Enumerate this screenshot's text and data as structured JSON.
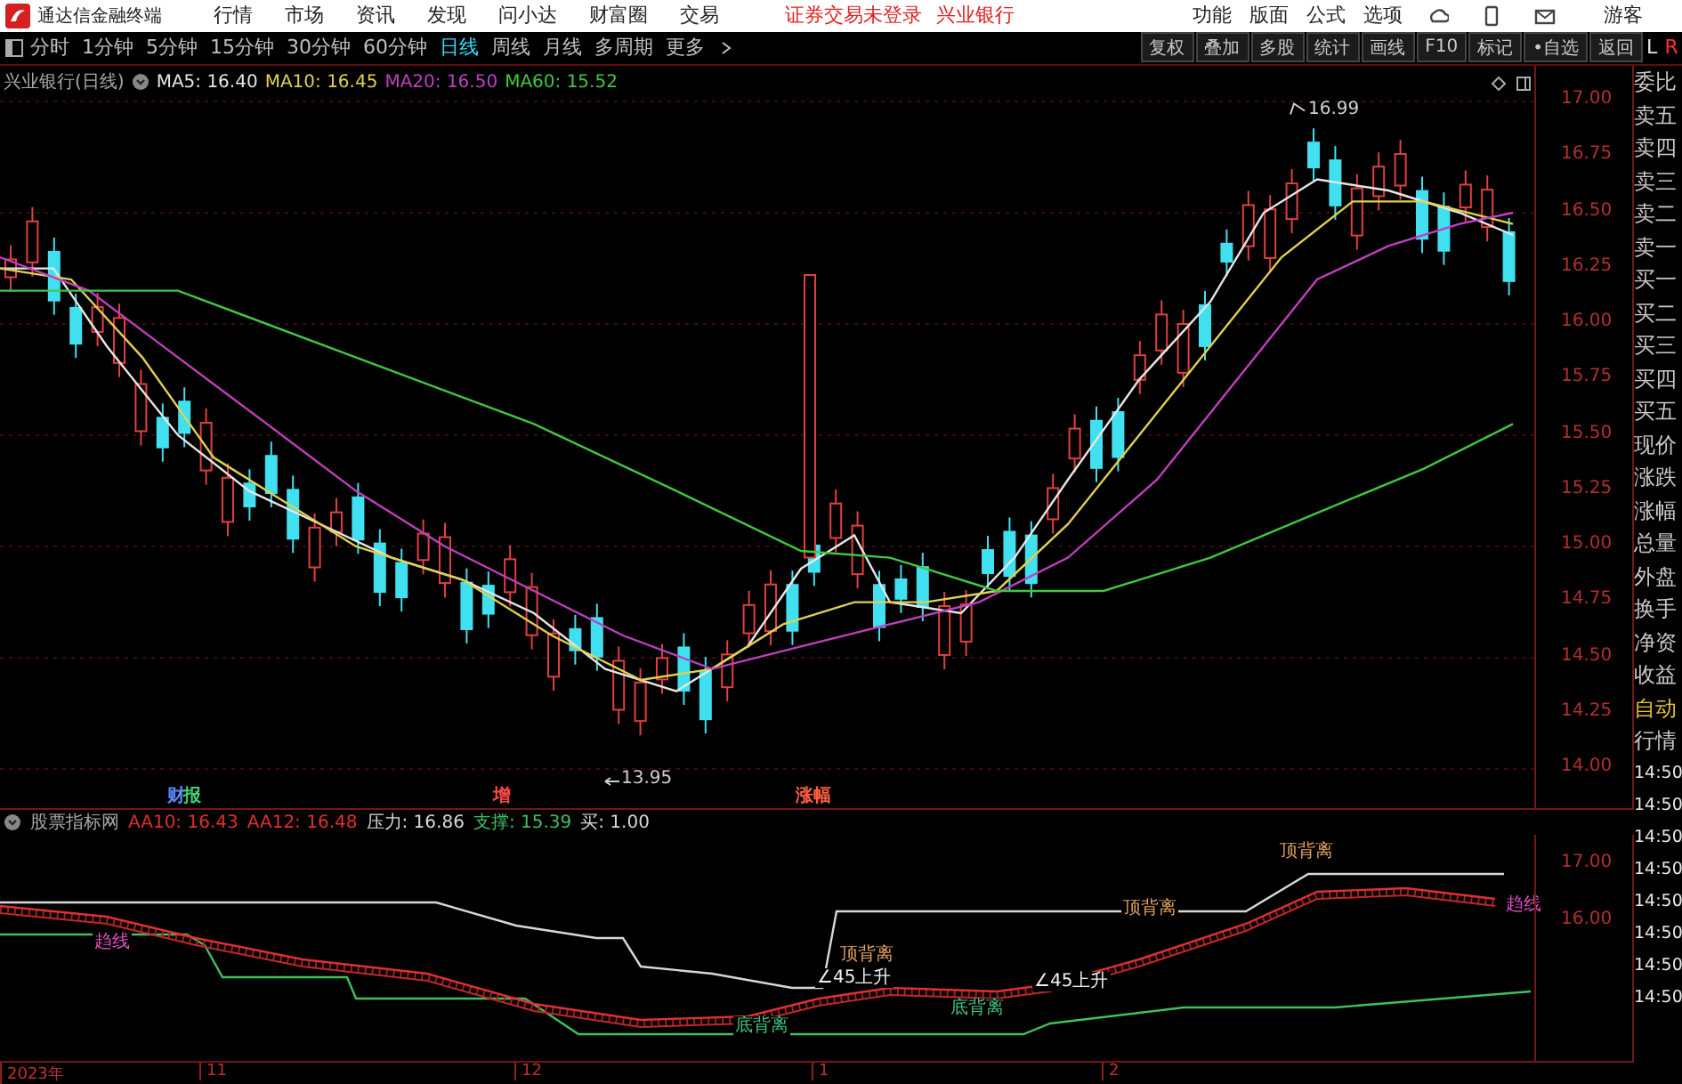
{
  "title_bar": {
    "app_title": "通达信金融终端",
    "menus": [
      "行情",
      "市场",
      "资讯",
      "发现",
      "问小达",
      "财富圈",
      "交易"
    ],
    "notices": [
      "证券交易未登录",
      "兴业银行"
    ],
    "right_menus": [
      "功能",
      "版面",
      "公式",
      "选项"
    ],
    "user": "游客"
  },
  "toolbar": {
    "periods": [
      {
        "label": "分时",
        "selected": false
      },
      {
        "label": "1分钟",
        "selected": false
      },
      {
        "label": "5分钟",
        "selected": false
      },
      {
        "label": "15分钟",
        "selected": false
      },
      {
        "label": "30分钟",
        "selected": false
      },
      {
        "label": "60分钟",
        "selected": false
      },
      {
        "label": "日线",
        "selected": true
      },
      {
        "label": "周线",
        "selected": false
      },
      {
        "label": "月线",
        "selected": false
      },
      {
        "label": "多周期",
        "selected": false
      },
      {
        "label": "更多",
        "selected": false
      }
    ],
    "buttons": [
      "复权",
      "叠加",
      "多股",
      "统计",
      "画线",
      "F10",
      "标记",
      "•自选",
      "返回"
    ],
    "side_marks": [
      "L",
      "R"
    ]
  },
  "price_chart": {
    "title": "兴业银行(日线)",
    "ma": [
      {
        "label": "MA5: 16.40",
        "color": "#e6e6e6"
      },
      {
        "label": "MA10: 16.45",
        "color": "#e0d050"
      },
      {
        "label": "MA20: 16.50",
        "color": "#c040c0"
      },
      {
        "label": "MA60: 15.52",
        "color": "#40c840"
      }
    ],
    "y_ticks": [
      "17.00",
      "16.75",
      "16.50",
      "16.25",
      "16.00",
      "15.75",
      "15.50",
      "15.25",
      "15.00",
      "14.75",
      "14.50",
      "14.25",
      "14.00"
    ],
    "high_label": "16.99",
    "low_label": "13.95",
    "events": [
      {
        "label": "财",
        "color": "#5a8cff"
      },
      {
        "label": "报",
        "color": "#40d070"
      },
      {
        "label": "增",
        "color": "#ff4848"
      },
      {
        "label": "涨幅",
        "color": "#ff6040"
      }
    ]
  },
  "indicator": {
    "name": "股票指标网",
    "values": [
      {
        "label": "AA10: 16.43",
        "color": "#e03030"
      },
      {
        "label": "AA12: 16.48",
        "color": "#e03030"
      },
      {
        "label": "压力: 16.86",
        "color": "#d8d8d8"
      },
      {
        "label": "支撑: 15.39",
        "color": "#40c060"
      },
      {
        "label": "买: 1.00",
        "color": "#d8d8d8"
      }
    ],
    "y_ticks": [
      "17.00",
      "16.00"
    ],
    "labels": [
      {
        "text": "顶背离",
        "color": "#e0a060"
      },
      {
        "text": "顶背离",
        "color": "#e0a060"
      },
      {
        "text": "顶背离",
        "color": "#e0a060"
      },
      {
        "text": "∠45上升",
        "color": "#f0f0f0"
      },
      {
        "text": "∠45上升",
        "color": "#f0f0f0"
      },
      {
        "text": "底背离",
        "color": "#40c080"
      },
      {
        "text": "底背离",
        "color": "#40c080"
      },
      {
        "text": "趋线",
        "color": "#e050c0"
      },
      {
        "text": "趋线",
        "color": "#e050c0"
      }
    ]
  },
  "date_axis": [
    "2023年",
    "11",
    "12",
    "1",
    "2"
  ],
  "quote_panel": {
    "rows": [
      "委比",
      "卖五",
      "卖四",
      "卖三",
      "卖二",
      "卖一",
      "买一",
      "买二",
      "买三",
      "买四",
      "买五",
      "现价",
      "涨跌",
      "涨幅",
      "总量",
      "外盘",
      "换手",
      "净资",
      "收益"
    ],
    "auto": "自动",
    "market": "行情",
    "times": [
      "14:50",
      "14:50",
      "14:50",
      "14:50",
      "14:50",
      "14:50",
      "14:50",
      "14:50"
    ]
  }
}
